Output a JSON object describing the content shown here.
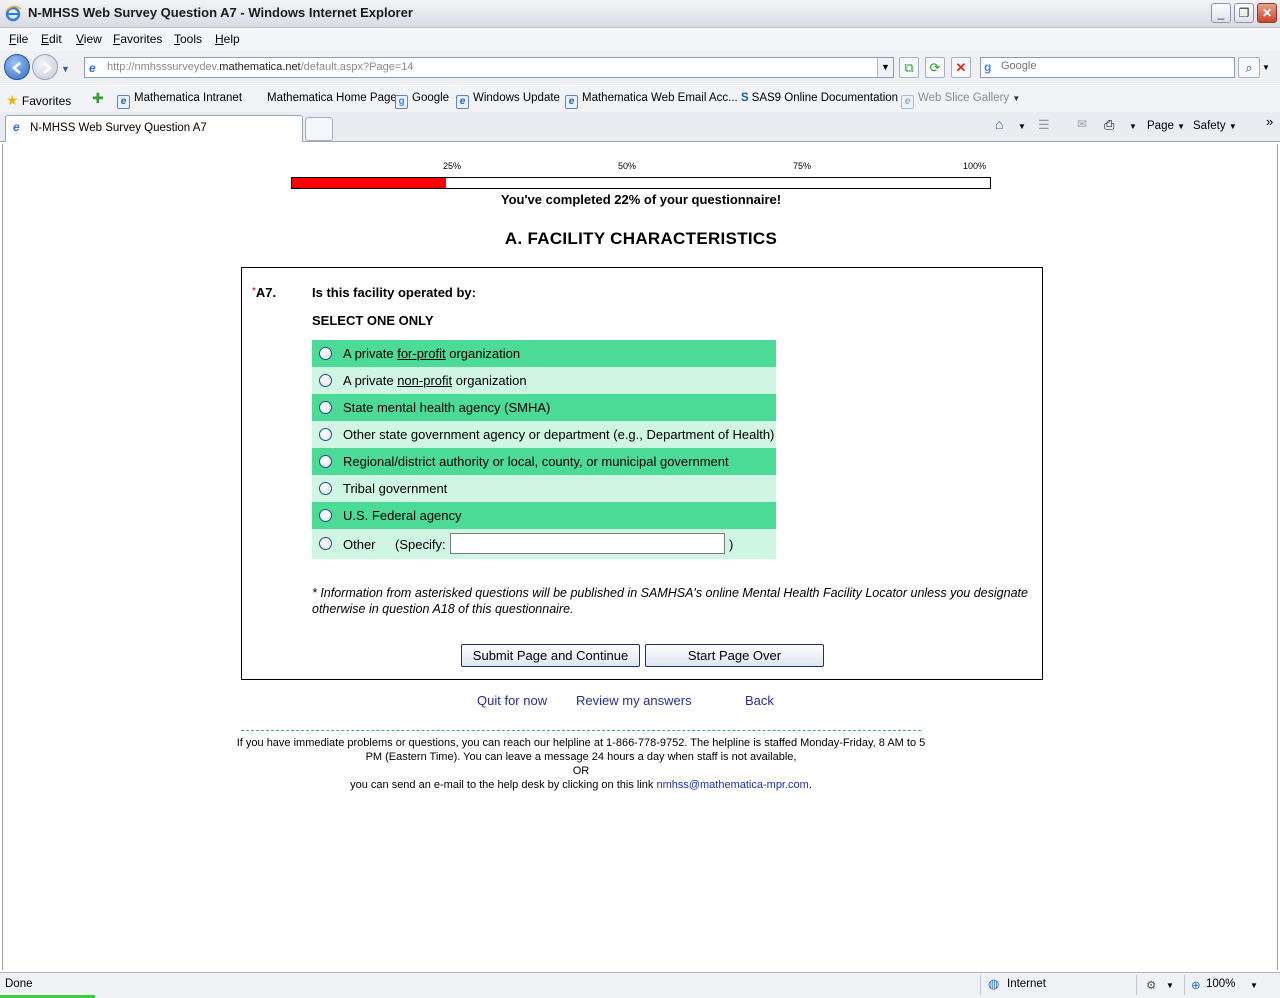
{
  "window": {
    "title": "N-MHSS Web Survey Question A7 - Windows Internet Explorer",
    "buttons": {
      "minimize": "_",
      "maximize": "❐",
      "close": "✕"
    }
  },
  "menu": {
    "items": [
      {
        "label": "File",
        "key": "F",
        "rest": "ile"
      },
      {
        "label": "Edit",
        "key": "E",
        "rest": "dit"
      },
      {
        "label": "View",
        "key": "V",
        "rest": "iew"
      },
      {
        "label": "Favorites",
        "key": "F",
        "rest": "avorites"
      },
      {
        "label": "Tools",
        "key": "T",
        "rest": "ools"
      },
      {
        "label": "Help",
        "key": "H",
        "rest": "elp"
      }
    ]
  },
  "address": {
    "url_prefix": "http://nmhsssurveydev.",
    "url_domain": "mathematica.net",
    "url_suffix": "/default.aspx?Page=14",
    "search_placeholder": "Google"
  },
  "favorites_bar": {
    "favorites_label": "Favorites",
    "links": [
      "Mathematica Intranet",
      "Mathematica Home Page",
      "Google",
      "Windows Update",
      "Mathematica Web Email Acc...",
      "SAS9 Online Documentation",
      "Web Slice Gallery"
    ]
  },
  "tab": {
    "title": "N-MHSS Web Survey Question A7"
  },
  "command_bar": {
    "page_label": "Page",
    "safety_label": "Safety",
    "chevron": "»"
  },
  "progress": {
    "labels": [
      "25%",
      "50%",
      "75%",
      "100%"
    ],
    "percent": 22,
    "text": "You've completed 22% of your questionnaire!"
  },
  "section_title": "A. FACILITY CHARACTERISTICS",
  "question": {
    "asterisk": "*",
    "number": "A7.",
    "text": "Is this facility operated by:",
    "instruction": "SELECT ONE ONLY",
    "options": [
      {
        "pre": "A private ",
        "u": "for-profit",
        "post": " organization"
      },
      {
        "pre": "A private ",
        "u": "non-profit",
        "post": " organization"
      },
      {
        "pre": "State mental health agency (SMHA)",
        "u": "",
        "post": ""
      },
      {
        "pre": "Other state government agency or department (e.g., Department of Health)",
        "u": "",
        "post": ""
      },
      {
        "pre": "Regional/district authority or local, county, or municipal government",
        "u": "",
        "post": ""
      },
      {
        "pre": "Tribal government",
        "u": "",
        "post": ""
      },
      {
        "pre": "U.S. Federal agency",
        "u": "",
        "post": ""
      }
    ],
    "other_label": "Other",
    "specify_label": "(Specify:",
    "specify_close": ")",
    "specify_value": "",
    "note": "* Information from asterisked questions will be published in SAMHSA's online Mental Health Facility Locator unless you designate otherwise in question A18 of this questionnaire."
  },
  "buttons": {
    "submit": "Submit Page and Continue",
    "start_over": "Start Page Over"
  },
  "nav_links": {
    "quit": "Quit for now",
    "review": "Review my answers",
    "back": "Back"
  },
  "help": {
    "line1": "If you have immediate problems or questions, you can reach our helpline at 1-866-778-9752. The helpline is staffed Monday-Friday, 8 AM to 5",
    "line2": "PM (Eastern Time). You can leave a message 24 hours a day when staff is not available,",
    "line3": "OR",
    "line4": "you can send an e-mail to the help desk by clicking on this link",
    "email": "nmhss@mathematica-mpr.com",
    "period": "."
  },
  "status": {
    "text": "Done",
    "zone": "Internet",
    "zoom": "100%"
  },
  "colors": {
    "progress_fill": "#ff0000",
    "option_dark": "#4cda97",
    "option_light": "#cff5e3",
    "link": "#2b2b8f"
  }
}
